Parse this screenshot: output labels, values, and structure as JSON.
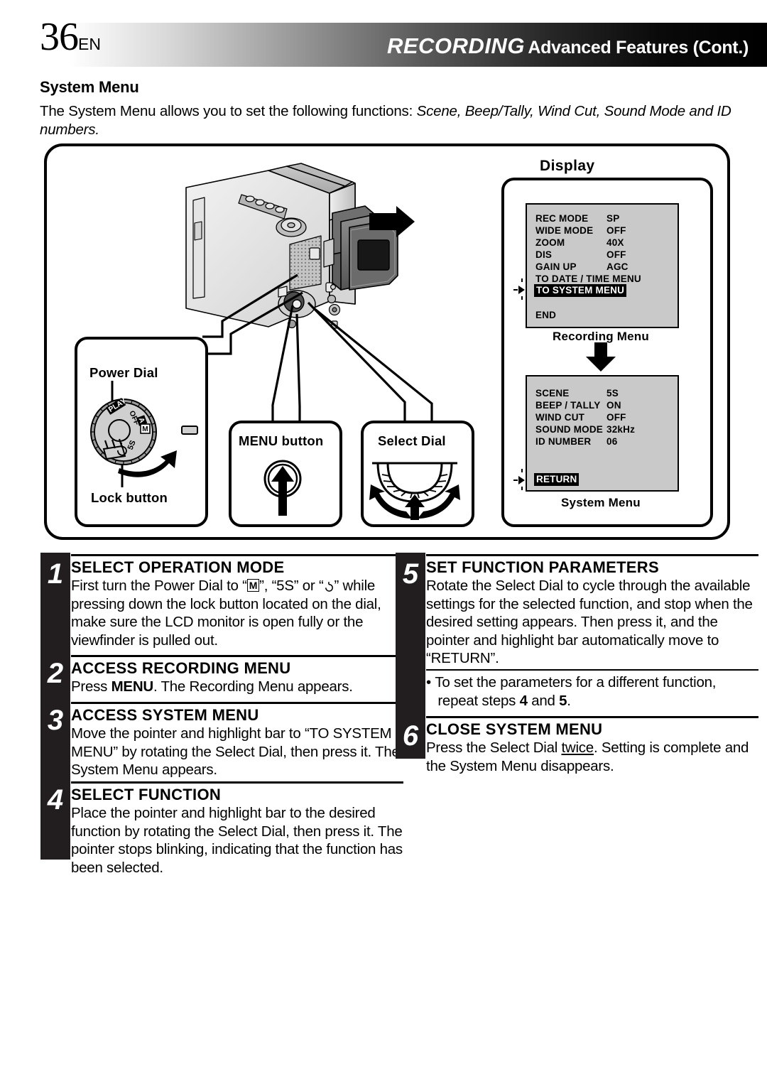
{
  "header": {
    "page_number": "36",
    "locale": "EN",
    "title_main": "RECORDING",
    "title_sub": "Advanced Features (Cont.)"
  },
  "section": {
    "heading": "System Menu",
    "intro_prefix": "The System Menu allows you to set the following functions: ",
    "intro_italic": "Scene, Beep/Tally, Wind Cut, Sound Mode and ID numbers."
  },
  "illustration": {
    "power_panel": {
      "power_dial_label": "Power Dial",
      "lock_button_label": "Lock button",
      "dial_marks": [
        "PLAY",
        "OFF",
        "A",
        "M",
        "5S",
        "power-symbol"
      ]
    },
    "menu_button_label": "MENU button",
    "select_dial_label": "Select Dial",
    "display_title": "Display"
  },
  "recording_menu": {
    "caption": "Recording Menu",
    "rows": [
      {
        "label": "REC MODE",
        "value": "SP"
      },
      {
        "label": "WIDE MODE",
        "value": "OFF"
      },
      {
        "label": "ZOOM",
        "value": "40X"
      },
      {
        "label": "DIS",
        "value": "OFF"
      },
      {
        "label": "GAIN UP",
        "value": "AGC"
      },
      {
        "label": "TO DATE / TIME MENU",
        "value": ""
      }
    ],
    "highlighted": "TO SYSTEM MENU",
    "end_label": "END"
  },
  "system_menu": {
    "caption": "System Menu",
    "rows": [
      {
        "label": "SCENE",
        "value": "5S"
      },
      {
        "label": "BEEP / TALLY",
        "value": "ON"
      },
      {
        "label": "WIND CUT",
        "value": "OFF"
      },
      {
        "label": "SOUND MODE",
        "value": "32kHz"
      },
      {
        "label": "ID NUMBER",
        "value": "06"
      }
    ],
    "highlighted": "RETURN"
  },
  "steps": [
    {
      "number": "1",
      "title": "SELECT OPERATION MODE",
      "body": "First turn the Power Dial to “M”, “5S” or “⏱” while pressing down the lock button located on the dial, make sure the LCD monitor is open fully or the viewfinder is pulled out."
    },
    {
      "number": "2",
      "title": "ACCESS RECORDING MENU",
      "body": "Press MENU. The Recording Menu appears."
    },
    {
      "number": "3",
      "title": "ACCESS SYSTEM MENU",
      "body": "Move the pointer and highlight bar to “TO SYSTEM MENU” by rotating the Select Dial, then press it. The System Menu appears."
    },
    {
      "number": "4",
      "title": "SELECT FUNCTION",
      "body": "Place the pointer and highlight bar to the desired function by rotating the Select Dial, then press it. The pointer stops blinking, indicating that the function has been selected."
    },
    {
      "number": "5",
      "title": "SET FUNCTION PARAMETERS",
      "body": "Rotate the Select Dial to cycle through the available settings for the selected function, and stop when the desired setting appears. Then press it, and the pointer and highlight bar automatically move to “RETURN”.",
      "note": "To set the parameters for a different function, repeat steps 4 and 5."
    },
    {
      "number": "6",
      "title": "CLOSE SYSTEM MENU",
      "body": "Press the Select Dial twice. Setting is complete and the System Menu disappears."
    }
  ],
  "colors": {
    "osd_background": "#c9c9c9",
    "bar_black": "#221e1f",
    "highlight_bg": "#000000",
    "highlight_fg": "#ffffff"
  }
}
